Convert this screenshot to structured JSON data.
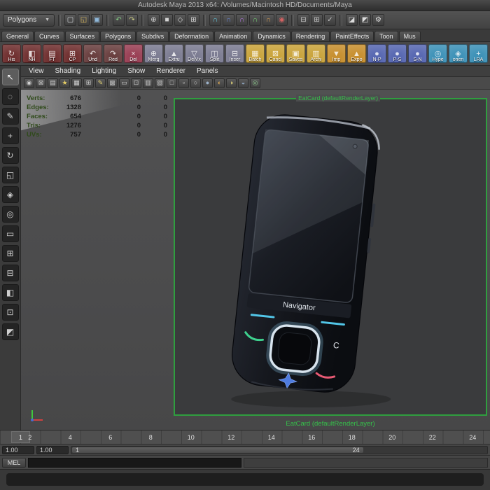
{
  "window": {
    "title": "Autodesk Maya 2013 x64: /Volumes/Macintosh HD/Documents/Maya"
  },
  "statusline": {
    "mode": "Polygons",
    "caret": "▼",
    "groups": {
      "g0": [
        {
          "n": "new-scene-icon",
          "g": "▢",
          "c": "#d6dade"
        },
        {
          "n": "open-scene-icon",
          "g": "◱",
          "c": "#dcba5e"
        },
        {
          "n": "save-scene-icon",
          "g": "▣",
          "c": "#8fb8da"
        }
      ],
      "g1": [
        {
          "n": "undo-icon",
          "g": "↶",
          "c": "#86d086"
        },
        {
          "n": "redo-icon",
          "g": "↷",
          "c": "#d0d086"
        }
      ],
      "g2": [
        {
          "n": "select-hierarchy-icon",
          "g": "⊕",
          "c": "#d4d4d4"
        },
        {
          "n": "select-object-icon",
          "g": "■",
          "c": "#d4d4d4"
        },
        {
          "n": "select-component-icon",
          "g": "◇",
          "c": "#d4d4d4"
        },
        {
          "n": "selection-mask-icon",
          "g": "⊞",
          "c": "#d4d4d4"
        }
      ],
      "g3": [
        {
          "n": "snap-to-grid-icon",
          "g": "∩",
          "c": "#62cbe2"
        },
        {
          "n": "snap-to-curve-icon",
          "g": "∩",
          "c": "#6c8ce2"
        },
        {
          "n": "snap-to-point-icon",
          "g": "∩",
          "c": "#b274e2"
        },
        {
          "n": "snap-to-view-plane-icon",
          "g": "∩",
          "c": "#74d274"
        },
        {
          "n": "snap-to-surface-icon",
          "g": "∩",
          "c": "#e2a252"
        },
        {
          "n": "make-live-icon",
          "g": "◉",
          "c": "#d26262"
        }
      ],
      "g4": [
        {
          "n": "input-connections-icon",
          "g": "⊟",
          "c": "#c6c6c6"
        },
        {
          "n": "output-connections-icon",
          "g": "⊞",
          "c": "#c6c6c6"
        },
        {
          "n": "construction-history-icon",
          "g": "✓",
          "c": "#c6c6c6"
        }
      ],
      "g5": [
        {
          "n": "render-current-frame-icon",
          "g": "◪",
          "c": "#dcdcdc"
        },
        {
          "n": "ipr-render-icon",
          "g": "◩",
          "c": "#dcdcdc"
        },
        {
          "n": "render-settings-icon",
          "g": "⚙",
          "c": "#dcdcdc"
        }
      ]
    }
  },
  "shelf": {
    "tabs": [
      "General",
      "Curves",
      "Surfaces",
      "Polygons",
      "Subdivs",
      "Deformation",
      "Animation",
      "Dynamics",
      "Rendering",
      "PaintEffects",
      "Toon",
      "Mus"
    ],
    "items": [
      {
        "label": "His",
        "g": "↻",
        "color": "#703030"
      },
      {
        "label": "NH",
        "g": "◧",
        "color": "#703030"
      },
      {
        "label": "FT",
        "g": "▤",
        "color": "#703030"
      },
      {
        "label": "CP",
        "g": "⊞",
        "color": "#703030"
      },
      {
        "label": "Und",
        "g": "↶",
        "color": "#6a4040"
      },
      {
        "label": "Red",
        "g": "↷",
        "color": "#6a4040"
      },
      {
        "label": "Del",
        "g": "×",
        "color": "#9a4055"
      },
      {
        "label": "Merg",
        "g": "⊕",
        "color": "#7c7c92"
      },
      {
        "label": "Extru",
        "g": "▲",
        "color": "#7c7c92"
      },
      {
        "label": "DelVx",
        "g": "▽",
        "color": "#7c7c92"
      },
      {
        "label": "Split",
        "g": "◫",
        "color": "#7c7c92"
      },
      {
        "label": "Inser",
        "g": "⊟",
        "color": "#7c7c92"
      },
      {
        "label": "Batch",
        "g": "▦",
        "color": "#caa43c"
      },
      {
        "label": "Cancl",
        "g": "⊠",
        "color": "#caa43c"
      },
      {
        "label": "Saves",
        "g": "▣",
        "color": "#caa43c"
      },
      {
        "label": "Archi",
        "g": "▥",
        "color": "#caa43c"
      },
      {
        "label": "Imp",
        "g": "▼",
        "color": "#c89030"
      },
      {
        "label": "Expo",
        "g": "▲",
        "color": "#c89030"
      },
      {
        "label": "N-P",
        "g": "●",
        "color": "#5868b2"
      },
      {
        "label": "P-S",
        "g": "●",
        "color": "#5868b2"
      },
      {
        "label": "S-N",
        "g": "●",
        "color": "#5868b2"
      },
      {
        "label": "Hype",
        "g": "◎",
        "color": "#3e92b8"
      },
      {
        "label": "orien",
        "g": "◈",
        "color": "#3e92b8"
      },
      {
        "label": "LRA",
        "g": "+",
        "color": "#3e92b8"
      }
    ]
  },
  "toolbox": {
    "items": [
      {
        "n": "select-tool",
        "g": "↖"
      },
      {
        "n": "lasso-tool",
        "g": "◌"
      },
      {
        "n": "paint-select-tool",
        "g": "✎"
      },
      {
        "n": "move-tool",
        "g": "+"
      },
      {
        "n": "rotate-tool",
        "g": "↻"
      },
      {
        "n": "scale-tool",
        "g": "◱"
      },
      {
        "n": "universal-manipulator-tool",
        "g": "◈"
      },
      {
        "n": "soft-modification-tool",
        "g": "◎"
      },
      {
        "n": "layout-single-pane-button",
        "g": "▭"
      },
      {
        "n": "layout-four-pane-button",
        "g": "⊞"
      },
      {
        "n": "layout-two-pane-button",
        "g": "⊟"
      },
      {
        "n": "layout-persp-outliner-button",
        "g": "◧"
      },
      {
        "n": "layout-persp-graph-button",
        "g": "⊡"
      },
      {
        "n": "layout-hypershade-button",
        "g": "◩"
      }
    ]
  },
  "panel": {
    "menu": [
      "View",
      "Shading",
      "Lighting",
      "Show",
      "Renderer",
      "Panels"
    ],
    "icons": [
      {
        "n": "select-camera-icon",
        "g": "◉",
        "c": "#d0d0d0"
      },
      {
        "n": "lock-camera-icon",
        "g": "⊠",
        "c": "#d0d0d0"
      },
      {
        "n": "camera-attributes-icon",
        "g": "▤",
        "c": "#d0d0d0"
      },
      {
        "n": "bookmark-icon",
        "g": "★",
        "c": "#e2ca62"
      },
      {
        "n": "image-plane-icon",
        "g": "▦",
        "c": "#d0d0d0"
      },
      {
        "n": "2d-pan-zoom-icon",
        "g": "⊞",
        "c": "#d0d0d0"
      },
      {
        "n": "grease-pencil-icon",
        "g": "✎",
        "c": "#e2d272"
      },
      {
        "n": "grid-icon",
        "g": "▩",
        "c": "#bcbcbc"
      },
      {
        "n": "film-gate-icon",
        "g": "▭",
        "c": "#d0d0d0"
      },
      {
        "n": "resolution-gate-icon",
        "g": "⊡",
        "c": "#d0d0d0"
      },
      {
        "n": "gate-mask-icon",
        "g": "▥",
        "c": "#d0d0d0"
      },
      {
        "n": "field-chart-icon",
        "g": "▧",
        "c": "#d0d0d0"
      },
      {
        "n": "safe-action-icon",
        "g": "□",
        "c": "#d0d0d0"
      },
      {
        "n": "safe-title-icon",
        "g": "▫",
        "c": "#d0d0d0"
      },
      {
        "n": "wireframe-mode-icon",
        "g": "○",
        "c": "#c8c8c8"
      },
      {
        "n": "smooth-shade-mode-icon",
        "g": "●",
        "c": "#9cb2ca"
      },
      {
        "n": "textured-mode-icon",
        "g": "◐",
        "c": "#d2a252"
      },
      {
        "n": "use-all-lights-icon",
        "g": "◑",
        "c": "#e8da7a"
      },
      {
        "n": "shadows-icon",
        "g": "◒",
        "c": "#8ca2ba"
      },
      {
        "n": "isolate-select-icon",
        "g": "◎",
        "c": "#8aca8a"
      }
    ]
  },
  "hud": {
    "rows": [
      {
        "label": "Verts:",
        "value": "676",
        "z1": "0",
        "z2": "0"
      },
      {
        "label": "Edges:",
        "value": "1328",
        "z1": "0",
        "z2": "0"
      },
      {
        "label": "Faces:",
        "value": "654",
        "z1": "0",
        "z2": "0"
      },
      {
        "label": "Tris:",
        "value": "1276",
        "z1": "0",
        "z2": "0"
      },
      {
        "label": "UVs:",
        "value": "757",
        "z1": "0",
        "z2": "0"
      }
    ]
  },
  "viewport": {
    "gate_top_label": "EatCard (defaultRenderLayer)",
    "camera_label": "EatCard (defaultRenderLayer)",
    "border_color": "#2f9e3f"
  },
  "phone": {
    "label": "Navigator",
    "key_c": "C"
  },
  "timeline": {
    "tick_labels": [
      "2",
      "4",
      "6",
      "8",
      "10",
      "12",
      "14",
      "16",
      "18",
      "20",
      "22",
      "24"
    ],
    "current_frame": "1",
    "range": {
      "start_field": "1.00",
      "end_field": "1.00",
      "bar_start": "1",
      "bar_end": "24"
    }
  },
  "mel": {
    "label": "MEL"
  },
  "colors": {
    "active_view_border": "#2f9e3f",
    "hud_label": "#2f4a1a",
    "camera_label_green": "#35c04a"
  }
}
